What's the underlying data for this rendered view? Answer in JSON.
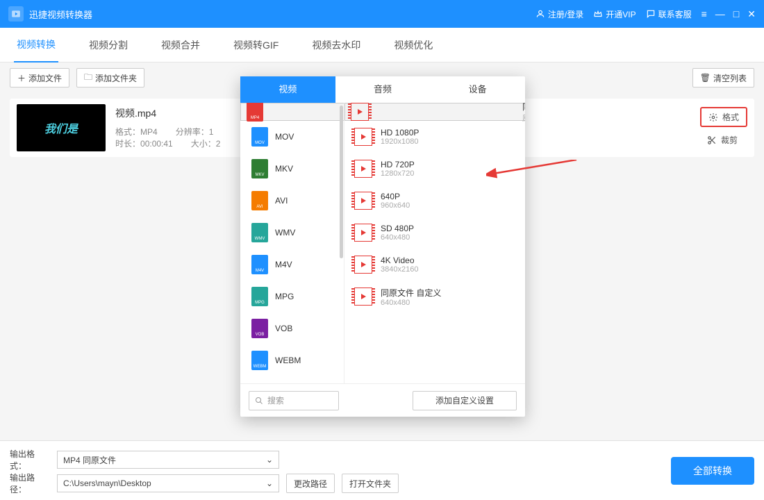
{
  "title": "迅捷视频转换器",
  "header": {
    "register": "注册/登录",
    "vip": "开通VIP",
    "support": "联系客服"
  },
  "tabs": [
    "视频转换",
    "视频分割",
    "视频合并",
    "视频转GIF",
    "视频去水印",
    "视频优化"
  ],
  "toolbar": {
    "addFile": "添加文件",
    "addFolder": "添加文件夹",
    "clear": "清空列表"
  },
  "file": {
    "name": "视频.mp4",
    "thumbText": "我们是",
    "formatLabel": "格式：",
    "formatVal": "MP4",
    "resLabel": "分辨率：",
    "resVal": "1",
    "durLabel": "时长：",
    "durVal": "00:00:41",
    "sizeLabel": "大小：",
    "sizeVal": "2",
    "actionFormat": "格式",
    "actionCrop": "裁剪"
  },
  "popup": {
    "tabs": [
      "视频",
      "音频",
      "设备"
    ],
    "formats": [
      {
        "label": "MP4",
        "color": "#E53935",
        "tag": "MP4"
      },
      {
        "label": "MOV",
        "color": "#1E90FF",
        "tag": "MOV"
      },
      {
        "label": "MKV",
        "color": "#2E7D32",
        "tag": "MKV"
      },
      {
        "label": "AVI",
        "color": "#F57C00",
        "tag": "AVI"
      },
      {
        "label": "WMV",
        "color": "#26A69A",
        "tag": "WMV"
      },
      {
        "label": "M4V",
        "color": "#1E90FF",
        "tag": "M4V"
      },
      {
        "label": "MPG",
        "color": "#26A69A",
        "tag": "MPG"
      },
      {
        "label": "VOB",
        "color": "#7B1FA2",
        "tag": "VOB"
      },
      {
        "label": "WEBM",
        "color": "#1E90FF",
        "tag": "WEBM"
      }
    ],
    "resolutions": [
      {
        "t1": "同原文件",
        "t2": "原视分辨率"
      },
      {
        "t1": "HD 1080P",
        "t2": "1920x1080"
      },
      {
        "t1": "HD 720P",
        "t2": "1280x720"
      },
      {
        "t1": "640P",
        "t2": "960x640"
      },
      {
        "t1": "SD 480P",
        "t2": "640x480"
      },
      {
        "t1": "4K Video",
        "t2": "3840x2160"
      },
      {
        "t1": "同原文件 自定义",
        "t2": "640x480"
      }
    ],
    "searchPlaceholder": "搜索",
    "customBtn": "添加自定义设置"
  },
  "bottom": {
    "fmtLabel": "输出格式：",
    "fmtVal": "MP4  同原文件",
    "pathLabel": "输出路径：",
    "pathVal": "C:\\Users\\mayn\\Desktop",
    "changePath": "更改路径",
    "openFolder": "打开文件夹",
    "convertAll": "全部转换"
  }
}
